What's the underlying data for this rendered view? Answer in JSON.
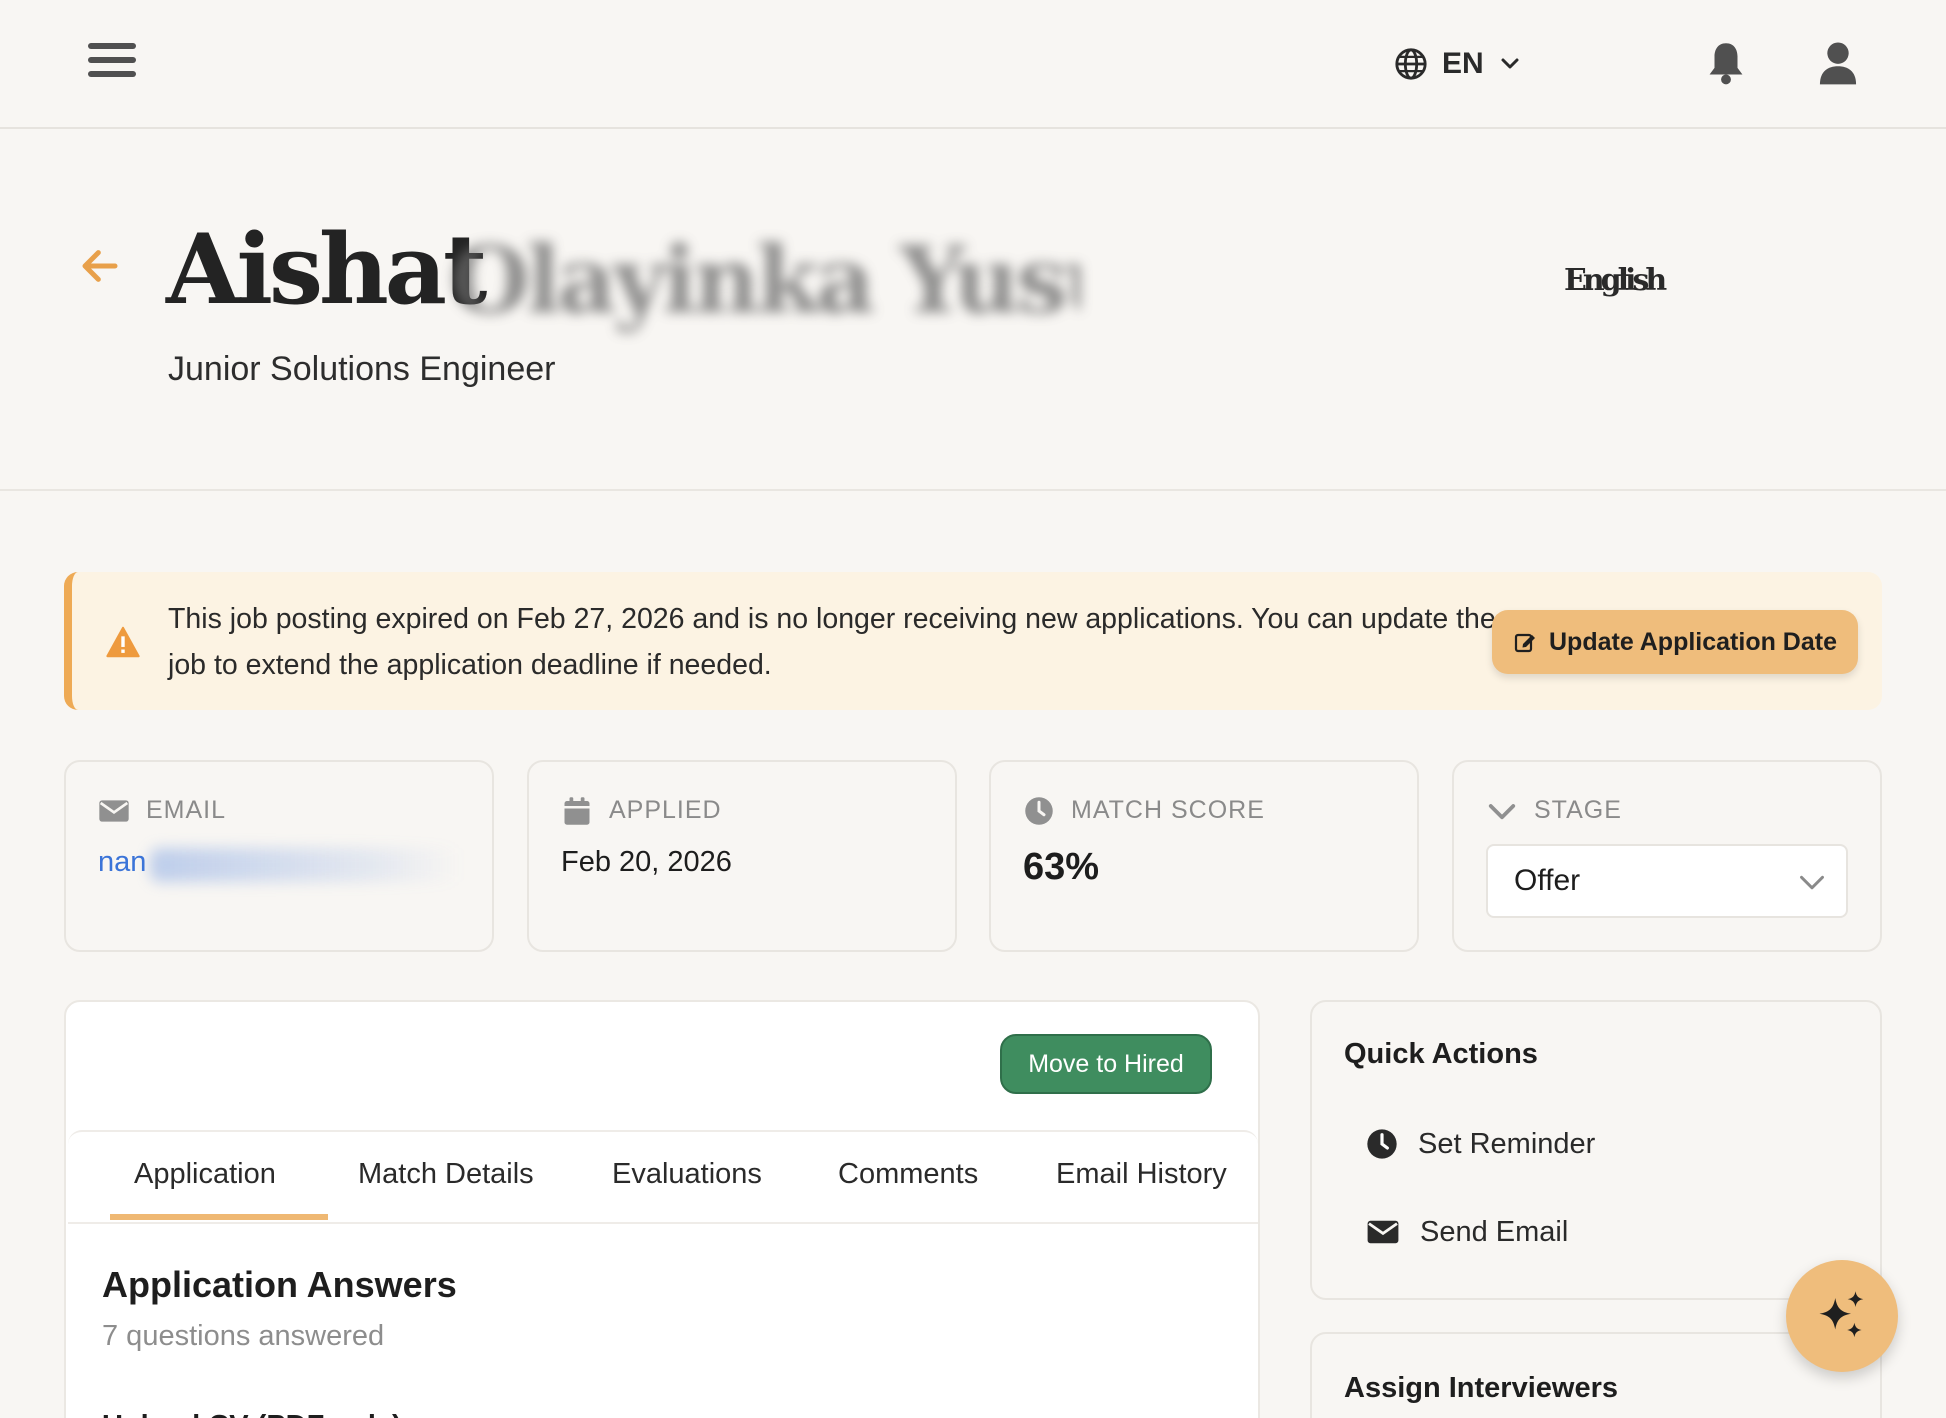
{
  "topbar": {
    "language_code": "EN",
    "language_name": "English"
  },
  "candidate": {
    "first_name": "Aishat",
    "last_name_redacted": "Olayinka Yusu",
    "role": "Junior Solutions Engineer"
  },
  "alert": {
    "message": "This job posting expired on Feb 27, 2026 and is no longer receiving new applications. You can update the job to extend the application deadline if needed.",
    "button": "Update Application Date"
  },
  "cards": {
    "email_label": "EMAIL",
    "email_value": "nan",
    "applied_label": "APPLIED",
    "applied_value": "Feb 20, 2026",
    "score_label": "MATCH SCORE",
    "score_value": "63%",
    "stage_label": "STAGE",
    "stage_value": "Offer"
  },
  "panel": {
    "move_button": "Move to Hired",
    "tabs": [
      "Application",
      "Match Details",
      "Evaluations",
      "Comments",
      "Email History"
    ],
    "active_tab": "Application",
    "answers_title": "Application Answers",
    "answers_sub": "7 questions answered",
    "cut_line": "Upload CV (PDF only)"
  },
  "quick_actions": {
    "title": "Quick Actions",
    "items": [
      "Set Reminder",
      "Send Email"
    ]
  },
  "assign": {
    "title": "Assign Interviewers"
  },
  "colors": {
    "accent": "#efbd7c",
    "alert_bg": "#fcf3e3",
    "hired_green": "#3f8d5f",
    "link_blue": "#3b74d8"
  },
  "icons": {
    "menu": "hamburger-icon",
    "language": "globe-icon",
    "notifications": "bell-icon",
    "account": "user-icon",
    "back": "arrow-left-icon",
    "fab": "sparkles-icon"
  }
}
